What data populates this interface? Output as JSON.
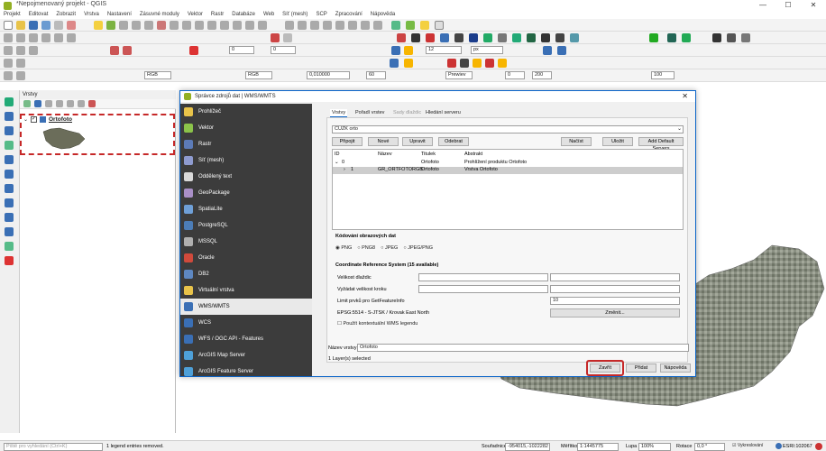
{
  "window": {
    "title": "*Nepojmenovaný projekt - QGIS",
    "controls": [
      "—",
      "☐",
      "✕"
    ]
  },
  "menu": [
    "Projekt",
    "Editovat",
    "Zobrazit",
    "Vrstva",
    "Nastavení",
    "Zásuvné moduly",
    "Vektor",
    "Rastr",
    "Databáze",
    "Web",
    "Síť (mesh)",
    "SCP",
    "Zpracování",
    "Nápověda"
  ],
  "toolbar": {
    "font_size": "12",
    "unit": "px",
    "scale1": "0,010000",
    "value_hlo": "60",
    "value_0": "0",
    "value_200": "200",
    "value_100": "100",
    "value_rgb": "RGB",
    "value_preview": "Prewiev"
  },
  "layers_panel": {
    "title": "Vrstvy",
    "layer_name": "Ortofoto"
  },
  "dialog": {
    "title": "Správce zdrojů dat | WMS/WMTS",
    "sidebar": [
      "Prohlížeč",
      "Vektor",
      "Rastr",
      "Síť (mesh)",
      "Oddělený text",
      "GeoPackage",
      "SpatiaLite",
      "PostgreSQL",
      "MSSQL",
      "Oracle",
      "DB2",
      "Virtuální vrstva",
      "WMS/WMTS",
      "WCS",
      "WFS / OGC API - Features",
      "ArcGIS Map Server",
      "ArcGIS Feature Server"
    ],
    "active_item": "WMS/WMTS",
    "tabs": [
      "Vrstvy",
      "Pořadí vrstev",
      "Sady dlaždic",
      "Hledání serveru"
    ],
    "connection": "CUZK orto",
    "buttons": {
      "connect": "Připojit",
      "new": "Nové",
      "edit": "Upravit",
      "remove": "Odebrat",
      "load": "Načíst",
      "save": "Uložit",
      "add_default": "Add Default Servers"
    },
    "table": {
      "headers": [
        "ID",
        "Název",
        "Titulek",
        "Abstrakt"
      ],
      "rows": [
        {
          "id": "0",
          "name": "",
          "title": "Ortofoto",
          "abstract": "Prohlížení produktu Ortofoto"
        },
        {
          "id": "1",
          "name": "GR_ORTFOTORGB",
          "title": "Ortofoto",
          "abstract": "Vrstva Ortofoto"
        }
      ]
    },
    "encoding": {
      "title": "Kódování obrazových dat",
      "options": [
        "PNG",
        "PNG8",
        "JPEG",
        "JPEG/PNG"
      ],
      "selected": "PNG"
    },
    "crs": {
      "title": "Coordinate Reference System (15 available)",
      "tile_size_label": "Velikost dlaždic",
      "step_label": "Vyžádat velikost kroku",
      "feature_limit_label": "Limit prvků pro GetFeatureInfo",
      "feature_limit_value": "10",
      "crs_label": "EPSG:5514 - S-JTSK / Krovak East North",
      "change_button": "Změnit...",
      "contextual_legend": "Použít kontextuální WMS legendu"
    },
    "layer_name_label": "Název vrstvy",
    "layer_name_value": "Ortofoto",
    "selected_info": "1 Layer(s) selected",
    "close_button": "Zavřít",
    "add_button": "Přidat",
    "help_button": "Nápověda"
  },
  "statusbar": {
    "search_placeholder": "Piště pro vyhledání (Ctrl+K)",
    "message": "1 legend entries removed.",
    "coord_label": "Souřadnice",
    "coord_value": "-954015,-1022282",
    "scale_label": "Měřítko",
    "scale_value": "1:1445775",
    "magnifier_label": "Lupa",
    "magnifier_value": "100%",
    "rotation_label": "Rotace",
    "rotation_value": "0,0 °",
    "render_label": "Vykreslování",
    "crs_value": "ESRI:102067"
  },
  "colors": {
    "accent": "#0a64c8",
    "highlight": "#c62828",
    "sidebar_bg": "#3c3c3c"
  }
}
